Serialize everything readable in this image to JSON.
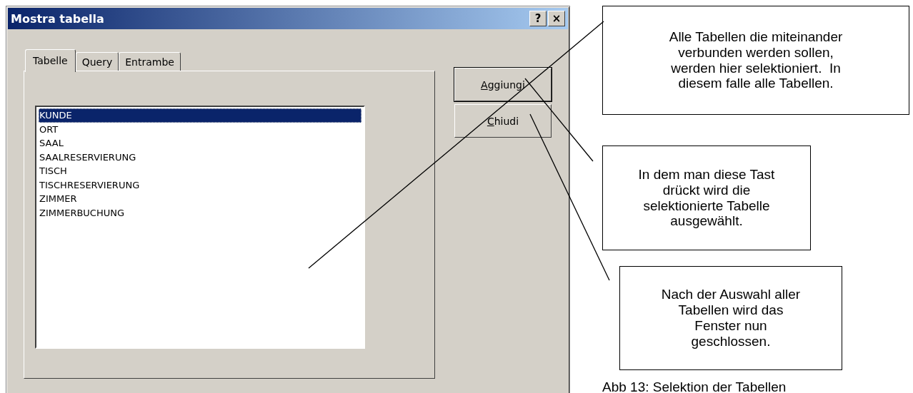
{
  "dialog": {
    "title": "Mostra tabella",
    "title_buttons": [
      "?",
      "×"
    ],
    "tabs": [
      {
        "label": "Tabelle",
        "selected": true
      },
      {
        "label": "Query",
        "selected": false
      },
      {
        "label": "Entrambe",
        "selected": false
      }
    ],
    "list": [
      {
        "label": "KUNDE",
        "selected": true
      },
      {
        "label": "ORT",
        "selected": false
      },
      {
        "label": "SAAL",
        "selected": false
      },
      {
        "label": "SAALRESERVIERUNG",
        "selected": false
      },
      {
        "label": "TISCH",
        "selected": false
      },
      {
        "label": "TISCHRESERVIERUNG",
        "selected": false
      },
      {
        "label": "ZIMMER",
        "selected": false
      },
      {
        "label": "ZIMMERBUCHUNG",
        "selected": false
      }
    ],
    "buttons": [
      {
        "label": "Aggiungi",
        "default": true
      },
      {
        "label": "Chiudi",
        "default": false
      }
    ]
  },
  "callouts": [
    "Alle Tabellen die miteinander verbunden werden sollen, werden hier selektioniert.  In diesem falle alle Tabellen.",
    "In dem man diese Tast drückt wird die selektionierte Tabelle ausgewählt.",
    "Nach der Auswahl aller Tabellen wird das Fenster nun geschlossen."
  ],
  "caption": "Abb 13: Selektion der Tabellen"
}
